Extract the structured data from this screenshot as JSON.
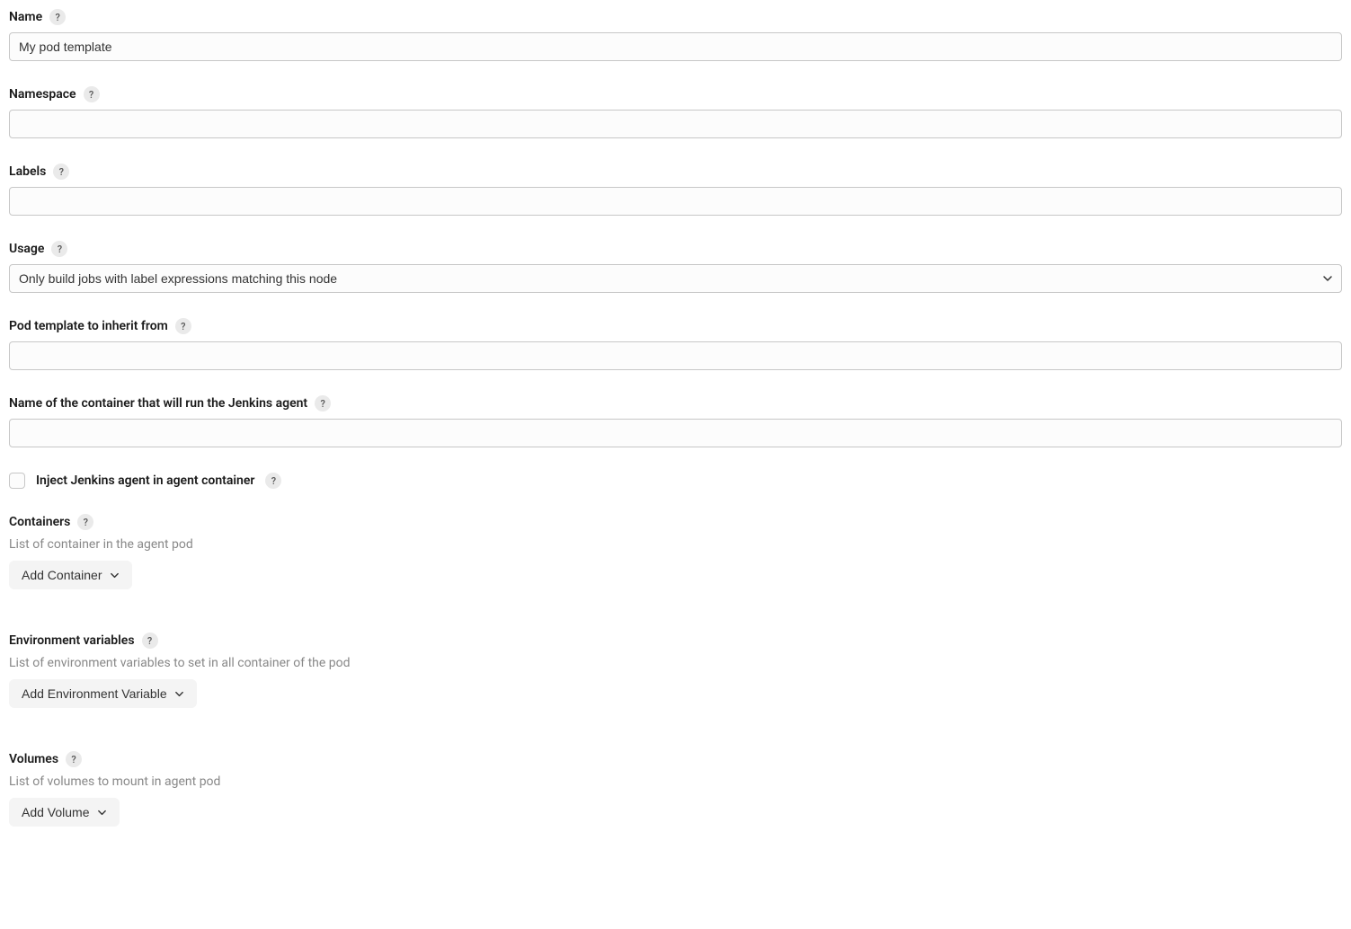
{
  "name": {
    "label": "Name",
    "value": "My pod template"
  },
  "namespace": {
    "label": "Namespace",
    "value": ""
  },
  "labels": {
    "label": "Labels",
    "value": ""
  },
  "usage": {
    "label": "Usage",
    "selected": "Only build jobs with label expressions matching this node"
  },
  "inherit": {
    "label": "Pod template to inherit from",
    "value": ""
  },
  "jenkinsContainer": {
    "label": "Name of the container that will run the Jenkins agent",
    "value": ""
  },
  "injectAgent": {
    "label": "Inject Jenkins agent in agent container",
    "checked": false
  },
  "containers": {
    "label": "Containers",
    "description": "List of container in the agent pod",
    "button": "Add Container"
  },
  "envVars": {
    "label": "Environment variables",
    "description": "List of environment variables to set in all container of the pod",
    "button": "Add Environment Variable"
  },
  "volumes": {
    "label": "Volumes",
    "description": "List of volumes to mount in agent pod",
    "button": "Add Volume"
  },
  "helpGlyph": "?"
}
